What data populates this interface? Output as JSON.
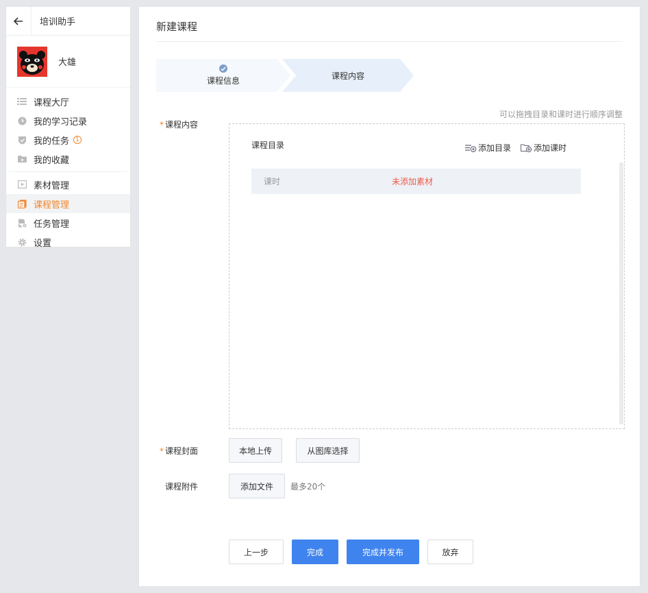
{
  "sidebar": {
    "title": "培训助手",
    "user_name": "大雄",
    "items": [
      {
        "label": "课程大厅",
        "icon": "list-icon"
      },
      {
        "label": "我的学习记录",
        "icon": "clock-icon"
      },
      {
        "label": "我的任务",
        "icon": "shield-icon",
        "badge": "1"
      },
      {
        "label": "我的收藏",
        "icon": "folder-icon"
      },
      {
        "label": "素材管理",
        "icon": "play-icon"
      },
      {
        "label": "课程管理",
        "icon": "book-icon",
        "active": true
      },
      {
        "label": "任务管理",
        "icon": "doc-gear-icon"
      },
      {
        "label": "设置",
        "icon": "gear-icon"
      }
    ]
  },
  "main": {
    "page_title": "新建课程",
    "steps": [
      {
        "label": "课程信息",
        "done": true
      },
      {
        "label": "课程内容",
        "active": true
      }
    ],
    "hint": "可以拖拽目录和课时进行顺序调整",
    "content_label": "课程内容",
    "catalog_title": "课程目录",
    "add_catalog": "添加目录",
    "add_lesson": "添加课时",
    "lesson": {
      "name": "课时",
      "status": "未添加素材"
    },
    "cover_label": "课程封面",
    "local_upload": "本地上传",
    "from_gallery": "从图库选择",
    "attachment_label": "课程附件",
    "add_file": "添加文件",
    "max_note": "最多20个",
    "buttons": {
      "prev": "上一步",
      "finish": "完成",
      "finish_publish": "完成并发布",
      "abandon": "放弃"
    }
  },
  "colors": {
    "accent_orange": "#f0862f",
    "primary_blue": "#3f83ee",
    "error_red": "#ee5b4a"
  }
}
